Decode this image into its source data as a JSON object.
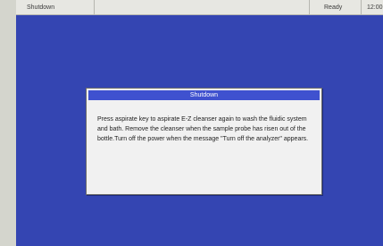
{
  "status_bar": {
    "screen_name": "Shutdown",
    "status": "Ready",
    "clock": "12:00"
  },
  "dialog": {
    "title": "Shutdown",
    "message": "Press aspirate key to aspirate E-Z cleanser  again to wash the fluidic system and bath.  Remove the cleanser when the sample probe has risen out of the bottle.Turn off the power when  the message \"Turn off the analyzer\" appears."
  },
  "colors": {
    "screen_background": "#3445b2",
    "title_bar": "#3f51cf",
    "dialog_background": "#f1f1f1"
  }
}
